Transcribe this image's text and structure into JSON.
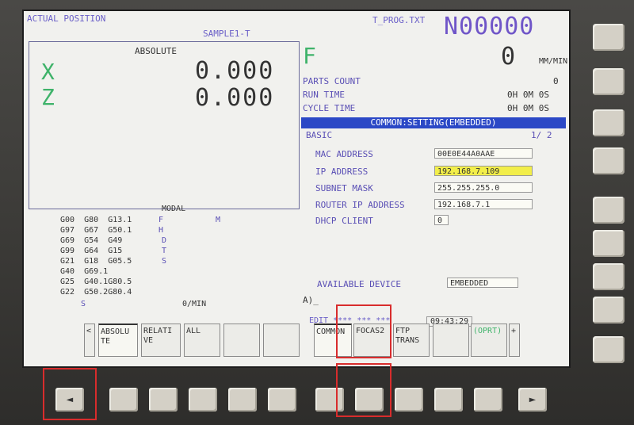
{
  "header": {
    "mode": "ACTUAL POSITION",
    "program": "SAMPLE1-T",
    "file": "T_PROG.TXT",
    "seq": "N00000"
  },
  "position": {
    "title": "ABSOLUTE",
    "axes": [
      {
        "name": "X",
        "value": "0.000"
      },
      {
        "name": "Z",
        "value": "0.000"
      }
    ]
  },
  "feed": {
    "letter": "F",
    "value": "0",
    "unit": "MM/MIN"
  },
  "stats": [
    {
      "label": "PARTS COUNT",
      "value": "0"
    },
    {
      "label": "RUN TIME",
      "value": "0H 0M 0S"
    },
    {
      "label": "CYCLE TIME",
      "value": "0H 0M 0S"
    }
  ],
  "settings": {
    "title": "COMMON:SETTING(EMBEDDED)",
    "section": "BASIC",
    "page": "1/ 2",
    "rows": [
      {
        "label": "MAC ADDRESS",
        "value": "00E0E44A0AAE"
      },
      {
        "label": "IP ADDRESS",
        "value": "192.168.7.109"
      },
      {
        "label": "SUBNET MASK",
        "value": "255.255.255.0"
      },
      {
        "label": "ROUTER IP ADDRESS",
        "value": "192.168.7.1"
      },
      {
        "label": "DHCP CLIENT",
        "value": "0"
      }
    ],
    "device_label": "AVAILABLE DEVICE",
    "device_value": "EMBEDDED"
  },
  "modal": {
    "title": "MODAL",
    "rows": [
      "G00  G80  G13.1",
      "G97  G67  G50.1",
      "G69  G54  G49",
      "G99  G64  G15",
      "G21  G18  G05.5",
      "G40  G69.1",
      "G25  G40.1G80.5",
      "G22  G50.2G80.4"
    ],
    "tags": [
      "F",
      "H",
      "D",
      "T",
      "S"
    ],
    "m_label": "M",
    "s_label": "S",
    "unit": "0/MIN"
  },
  "editline": {
    "prompt": "A)_",
    "mode": "EDIT **** *** ***",
    "time": "09:43:29"
  },
  "softkeys": [
    {
      "label": "<"
    },
    {
      "label": "ABSOLU TE"
    },
    {
      "label": "RELATI VE"
    },
    {
      "label": "ALL"
    },
    {
      "label": ""
    },
    {
      "label": ""
    },
    {
      "label": "COMMON"
    },
    {
      "label": "FOCAS2"
    },
    {
      "label": "FTP TRANS"
    },
    {
      "label": ""
    },
    {
      "label": "(OPRT)"
    },
    {
      "label": "+"
    }
  ],
  "panel": {
    "left_arrow": "◄",
    "right_arrow": "►"
  }
}
